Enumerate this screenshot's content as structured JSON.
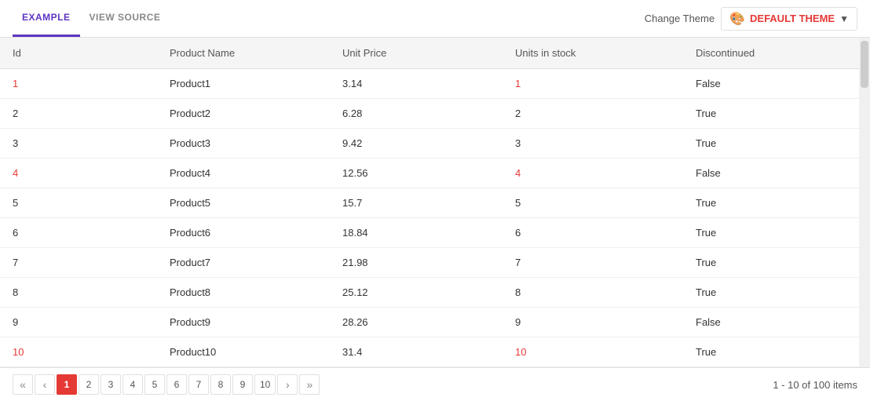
{
  "header": {
    "tab_example": "EXAMPLE",
    "tab_view_source": "VIEW SOURCE",
    "change_theme_label": "Change Theme",
    "theme_name": "DEFAULT THEME",
    "theme_icon": "🎨"
  },
  "table": {
    "columns": [
      {
        "key": "id",
        "label": "Id"
      },
      {
        "key": "product_name",
        "label": "Product Name"
      },
      {
        "key": "unit_price",
        "label": "Unit Price"
      },
      {
        "key": "units_in_stock",
        "label": "Units in stock"
      },
      {
        "key": "discontinued",
        "label": "Discontinued"
      }
    ],
    "rows": [
      {
        "id": "1",
        "product_name": "Product1",
        "unit_price": "3.14",
        "units_in_stock": "1",
        "discontinued": "False",
        "id_highlight": true,
        "stock_highlight": true
      },
      {
        "id": "2",
        "product_name": "Product2",
        "unit_price": "6.28",
        "units_in_stock": "2",
        "discontinued": "True",
        "id_highlight": false,
        "stock_highlight": false
      },
      {
        "id": "3",
        "product_name": "Product3",
        "unit_price": "9.42",
        "units_in_stock": "3",
        "discontinued": "True",
        "id_highlight": false,
        "stock_highlight": false
      },
      {
        "id": "4",
        "product_name": "Product4",
        "unit_price": "12.56",
        "units_in_stock": "4",
        "discontinued": "False",
        "id_highlight": true,
        "stock_highlight": true
      },
      {
        "id": "5",
        "product_name": "Product5",
        "unit_price": "15.7",
        "units_in_stock": "5",
        "discontinued": "True",
        "id_highlight": false,
        "stock_highlight": false
      },
      {
        "id": "6",
        "product_name": "Product6",
        "unit_price": "18.84",
        "units_in_stock": "6",
        "discontinued": "True",
        "id_highlight": false,
        "stock_highlight": false
      },
      {
        "id": "7",
        "product_name": "Product7",
        "unit_price": "21.98",
        "units_in_stock": "7",
        "discontinued": "True",
        "id_highlight": false,
        "stock_highlight": false
      },
      {
        "id": "8",
        "product_name": "Product8",
        "unit_price": "25.12",
        "units_in_stock": "8",
        "discontinued": "True",
        "id_highlight": false,
        "stock_highlight": false
      },
      {
        "id": "9",
        "product_name": "Product9",
        "unit_price": "28.26",
        "units_in_stock": "9",
        "discontinued": "False",
        "id_highlight": false,
        "stock_highlight": false
      },
      {
        "id": "10",
        "product_name": "Product10",
        "unit_price": "31.4",
        "units_in_stock": "10",
        "discontinued": "True",
        "id_highlight": true,
        "stock_highlight": true
      }
    ]
  },
  "pagination": {
    "pages": [
      "1",
      "2",
      "3",
      "4",
      "5",
      "6",
      "7",
      "8",
      "9",
      "10"
    ],
    "active_page": "1",
    "info": "1 - 10 of 100 items",
    "first_label": "«",
    "prev_label": "‹",
    "next_label": "›",
    "last_label": "»"
  }
}
